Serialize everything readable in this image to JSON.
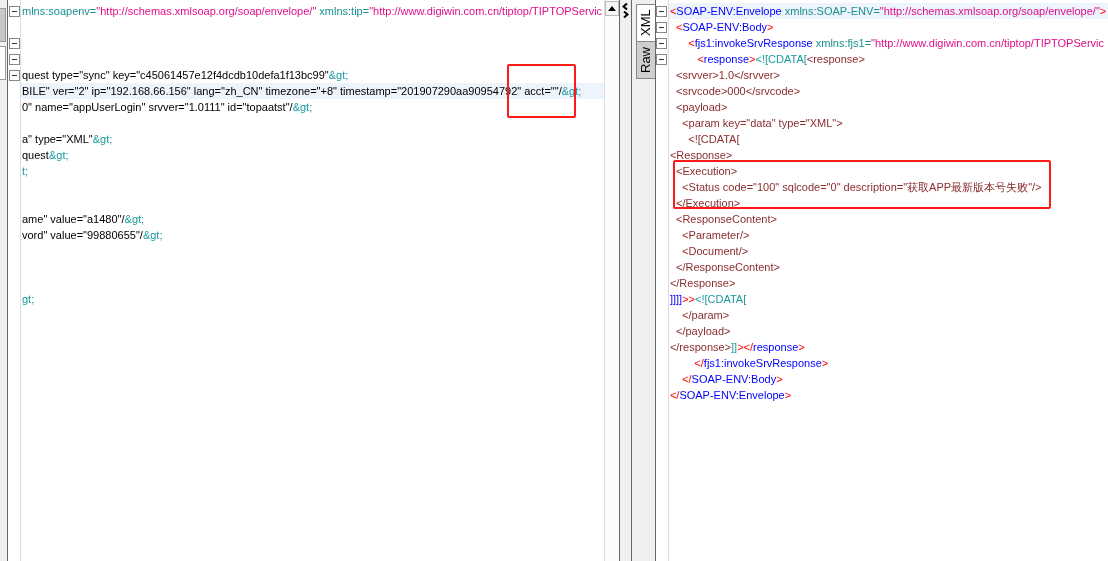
{
  "request_pane": {
    "lines": [
      {
        "fold": true,
        "selected": false,
        "segments": [
          {
            "text": "mlns:soapenv=",
            "kind": "attr"
          },
          {
            "text": "\"http://schemas.xmlsoap.org/soap/envelope/\"",
            "kind": "value"
          },
          {
            "text": " xmlns:tip=",
            "kind": "attr"
          },
          {
            "text": "\"http://www.digiwin.com.cn/tiptop/TIPTOPServic",
            "kind": "value"
          }
        ]
      },
      {
        "fold": false,
        "selected": false
      },
      {
        "fold": true,
        "selected": false
      },
      {
        "fold": true,
        "selected": false
      },
      {
        "fold": true,
        "selected": false,
        "segments": [
          {
            "text": "quest type=\"sync\" key=\"c45061457e12f4dcdb10defa1f13bc99\"",
            "kind": "text"
          },
          {
            "text": "&gt;",
            "kind": "entity"
          }
        ]
      },
      {
        "fold": false,
        "selected": true,
        "segments": [
          {
            "text": "BILE\" ver=\"2\" ip=\"192.168.66.156\" lang=\"zh_CN\" timezone=\"+8\" timestamp=\"201907290aa9095479",
            "kind": "text"
          },
          {
            "text": "2\" acct=\"\"/",
            "kind": "text",
            "boxed": true
          },
          {
            "text": "&gt;",
            "kind": "entity"
          }
        ]
      },
      {
        "fold": false,
        "selected": false,
        "segments": [
          {
            "text": "0\" name=\"appUserLogin\" srvver=\"1.0111\" id=\"topaatst\"/",
            "kind": "text"
          },
          {
            "text": "&gt;",
            "kind": "entity"
          }
        ]
      },
      {
        "fold": false,
        "selected": false
      },
      {
        "fold": false,
        "selected": false,
        "segments": [
          {
            "text": "a\" type=\"XML\"",
            "kind": "text"
          },
          {
            "text": "&gt;",
            "kind": "entity"
          }
        ]
      },
      {
        "fold": false,
        "selected": false,
        "segments": [
          {
            "text": "quest",
            "kind": "text"
          },
          {
            "text": "&gt;",
            "kind": "entity"
          }
        ]
      },
      {
        "fold": false,
        "selected": false,
        "segments": [
          {
            "text": "t;",
            "kind": "entity"
          }
        ]
      },
      {
        "fold": false,
        "selected": false
      },
      {
        "fold": false,
        "selected": false
      },
      {
        "fold": false,
        "selected": false,
        "segments": [
          {
            "text": "ame\" value=\"a1480\"/",
            "kind": "text"
          },
          {
            "text": "&gt;",
            "kind": "entity"
          }
        ]
      },
      {
        "fold": false,
        "selected": false,
        "segments": [
          {
            "text": "vord\" value=\"99880655\"/",
            "kind": "text"
          },
          {
            "text": "&gt;",
            "kind": "entity"
          }
        ]
      },
      {
        "fold": false,
        "selected": false
      },
      {
        "fold": false,
        "selected": false
      },
      {
        "fold": false,
        "selected": false
      },
      {
        "fold": false,
        "selected": false,
        "segments": [
          {
            "text": "gt;",
            "kind": "entity"
          }
        ]
      }
    ]
  },
  "response_pane": {
    "tabs": [
      {
        "label": "XML",
        "selected": true
      },
      {
        "label": "Raw",
        "selected": false
      }
    ],
    "lines": [
      {
        "fold": true,
        "selected": true,
        "segments": [
          {
            "text": "<",
            "kind": "tag"
          },
          {
            "text": "SOAP-ENV:Envelope",
            "kind": "name"
          },
          {
            "text": " xmlns:SOAP-ENV=",
            "kind": "attr"
          },
          {
            "text": "\"http://schemas.xmlsoap.org/soap/envelope/\"",
            "kind": "value"
          },
          {
            "text": ">",
            "kind": "tag"
          }
        ]
      },
      {
        "fold": true,
        "selected": false,
        "segments": [
          {
            "text": "  <",
            "kind": "tag"
          },
          {
            "text": "SOAP-ENV:Body",
            "kind": "name"
          },
          {
            "text": ">",
            "kind": "tag"
          }
        ]
      },
      {
        "fold": true,
        "selected": false,
        "segments": [
          {
            "text": "      <",
            "kind": "tag"
          },
          {
            "text": "fjs1:invokeSrvResponse",
            "kind": "name"
          },
          {
            "text": " xmlns:fjs1=",
            "kind": "attr"
          },
          {
            "text": "\"http://www.digiwin.com.cn/tiptop/TIPTOPServic",
            "kind": "value"
          }
        ]
      },
      {
        "fold": true,
        "selected": false,
        "segments": [
          {
            "text": "         <",
            "kind": "tag"
          },
          {
            "text": "response",
            "kind": "name"
          },
          {
            "text": ">",
            "kind": "tag"
          },
          {
            "text": "<![CDATA[",
            "kind": "cdata"
          },
          {
            "text": "<response>",
            "kind": "raw"
          }
        ]
      },
      {
        "fold": false,
        "selected": false,
        "segments": [
          {
            "text": "  <srvver>1.0</srvver>",
            "kind": "raw"
          }
        ]
      },
      {
        "fold": false,
        "selected": false,
        "segments": [
          {
            "text": "  <srvcode>000</srvcode>",
            "kind": "raw"
          }
        ]
      },
      {
        "fold": false,
        "selected": false,
        "segments": [
          {
            "text": "  <payload>",
            "kind": "raw"
          }
        ]
      },
      {
        "fold": false,
        "selected": false,
        "segments": [
          {
            "text": "    <param key=\"data\" type=\"XML\">",
            "kind": "raw"
          }
        ]
      },
      {
        "fold": false,
        "selected": false,
        "segments": [
          {
            "text": "      <![CDATA[",
            "kind": "raw"
          }
        ]
      },
      {
        "fold": false,
        "selected": false,
        "segments": [
          {
            "text": "<Response>",
            "kind": "raw"
          }
        ]
      },
      {
        "fold": false,
        "selected": false,
        "segments": [
          {
            "text": "  <Execution>",
            "kind": "raw"
          }
        ]
      },
      {
        "fold": false,
        "selected": false,
        "boxed": true,
        "segments": [
          {
            "text": "    <Status code=\"100\" sqlcode=\"0\" description=\"获取APP最新版本号失败\"/>",
            "kind": "raw"
          }
        ]
      },
      {
        "fold": false,
        "selected": false,
        "segments": [
          {
            "text": "  </Execution>",
            "kind": "raw"
          }
        ]
      },
      {
        "fold": false,
        "selected": false,
        "segments": [
          {
            "text": "  <ResponseContent>",
            "kind": "raw"
          }
        ]
      },
      {
        "fold": false,
        "selected": false,
        "segments": [
          {
            "text": "    <Parameter/>",
            "kind": "raw"
          }
        ]
      },
      {
        "fold": false,
        "selected": false,
        "segments": [
          {
            "text": "    <Document/>",
            "kind": "raw"
          }
        ]
      },
      {
        "fold": false,
        "selected": false,
        "segments": [
          {
            "text": "  </ResponseContent>",
            "kind": "raw"
          }
        ]
      },
      {
        "fold": false,
        "selected": false,
        "segments": [
          {
            "text": "</Response>",
            "kind": "raw"
          }
        ]
      },
      {
        "fold": false,
        "selected": false,
        "segments": [
          {
            "text": "]]]]",
            "kind": "name"
          },
          {
            "text": ">>",
            "kind": "tag"
          },
          {
            "text": "<![CDATA[",
            "kind": "cdata"
          }
        ]
      },
      {
        "fold": false,
        "selected": false,
        "segments": [
          {
            "text": "    </param>",
            "kind": "raw"
          }
        ]
      },
      {
        "fold": false,
        "selected": false,
        "segments": [
          {
            "text": "  </payload>",
            "kind": "raw"
          }
        ]
      },
      {
        "fold": false,
        "selected": false,
        "segments": [
          {
            "text": "</response>",
            "kind": "raw"
          },
          {
            "text": "]]",
            "kind": "cdata"
          },
          {
            "text": "></",
            "kind": "tag"
          },
          {
            "text": "response",
            "kind": "name"
          },
          {
            "text": ">",
            "kind": "tag"
          }
        ]
      },
      {
        "fold": false,
        "selected": false,
        "segments": [
          {
            "text": "        </",
            "kind": "tag"
          },
          {
            "text": "fjs1:invokeSrvResponse",
            "kind": "name"
          },
          {
            "text": ">",
            "kind": "tag"
          }
        ]
      },
      {
        "fold": false,
        "selected": false,
        "segments": [
          {
            "text": "    </",
            "kind": "tag"
          },
          {
            "text": "SOAP-ENV:Body",
            "kind": "name"
          },
          {
            "text": ">",
            "kind": "tag"
          }
        ]
      },
      {
        "fold": false,
        "selected": false,
        "segments": [
          {
            "text": "</",
            "kind": "tag"
          },
          {
            "text": "SOAP-ENV:Envelope",
            "kind": "name"
          },
          {
            "text": ">",
            "kind": "tag"
          }
        ]
      }
    ]
  }
}
